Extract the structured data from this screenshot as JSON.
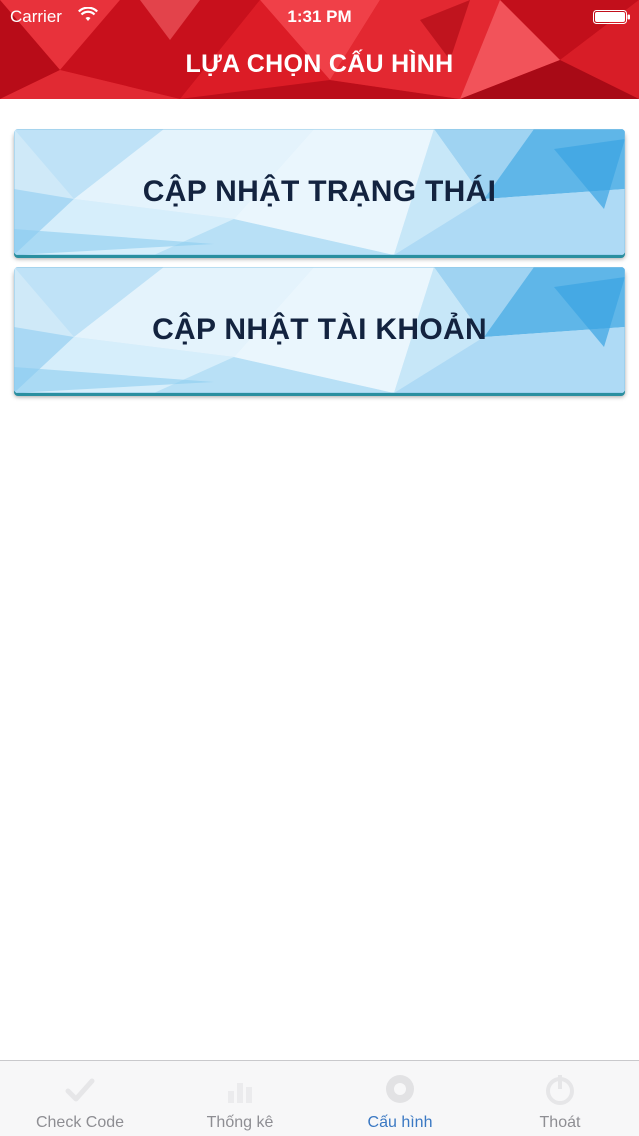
{
  "status_bar": {
    "carrier": "Carrier",
    "time": "1:31 PM"
  },
  "header": {
    "title": "LỰA CHỌN CẤU HÌNH",
    "background_color": "#d71923"
  },
  "menu": [
    {
      "label": "CẬP NHẬT TRẠNG THÁI"
    },
    {
      "label": "CẬP NHẬT TÀI KHOẢN"
    }
  ],
  "tabbar": {
    "active_color": "#3a78c3",
    "inactive_color": "#8e8e93",
    "tabs": [
      {
        "label": "Check Code",
        "icon": "checkmark-icon"
      },
      {
        "label": "Thống kê",
        "icon": "chart-icon"
      },
      {
        "label": "Cấu hình",
        "icon": "gear-icon",
        "active": true
      },
      {
        "label": "Thoát",
        "icon": "logout-icon"
      }
    ]
  }
}
